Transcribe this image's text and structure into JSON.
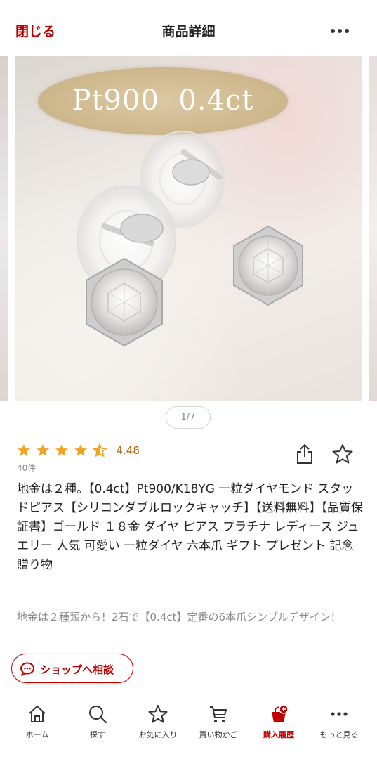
{
  "header": {
    "close_label": "閉じる",
    "title": "商品詳細",
    "more_icon": "more-horizontal-icon"
  },
  "gallery": {
    "overlay_text": "Pt900  0.4ct",
    "pager": "1/7"
  },
  "product": {
    "rating": 4.48,
    "rating_label": "4.48",
    "review_count": "40件",
    "title": "地金は２種。【0.4ct】Pt900/K18YG 一粒ダイヤモンド スタッドピアス【シリコンダブルロックキャッチ】【送料無料】【品質保証書】ゴールド １８金 ダイヤ ピアス プラチナ レディース ジュエリー 人気  可愛い 一粒ダイヤ 六本爪 ギフト プレゼント 記念 贈り物",
    "catch_copy": "地金は２種類から！2石で【0.4ct】定番の6本爪シンプルデザイン！"
  },
  "actions": {
    "share_icon": "share-icon",
    "favorite_icon": "star-outline-icon",
    "consult_label": "ショップへ相談"
  },
  "tabbar": {
    "items": [
      {
        "label": "ホーム",
        "icon": "home-icon"
      },
      {
        "label": "探す",
        "icon": "search-icon"
      },
      {
        "label": "お気に入り",
        "icon": "star-icon"
      },
      {
        "label": "買い物かご",
        "icon": "cart-icon"
      },
      {
        "label": "購入履歴",
        "icon": "purchase-history-icon",
        "active": true
      },
      {
        "label": "もっと見る",
        "icon": "more-icon"
      }
    ]
  },
  "colors": {
    "brand": "#bf0000",
    "star": "#f0a422",
    "muted": "#888888"
  }
}
